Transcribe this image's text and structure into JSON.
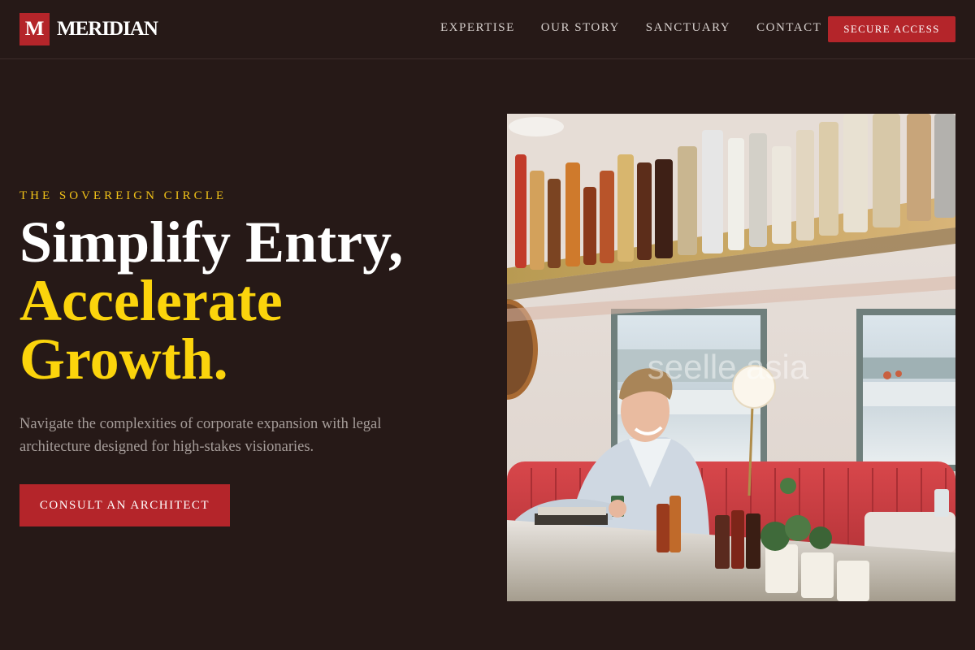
{
  "brand": {
    "mark": "M",
    "name": "MERIDIAN"
  },
  "nav": {
    "items": [
      {
        "label": "EXPERTISE"
      },
      {
        "label": "OUR STORY"
      },
      {
        "label": "SANCTUARY"
      },
      {
        "label": "CONTACT"
      }
    ],
    "cta_label": "SECURE ACCESS"
  },
  "hero": {
    "eyebrow": "THE SOVEREIGN CIRCLE",
    "headline_line1": "Simplify Entry,",
    "headline_line2": "Accelerate",
    "headline_line3": "Growth.",
    "subcopy": "Navigate the complexities of corporate expansion with legal architecture designed for high-stakes visionaries.",
    "cta_label": "CONSULT AN ARCHITECT",
    "image": {
      "alt": "Smiling man holding a drink at a bar with bottles on shelves and red booth seating",
      "watermark": "seelle asia"
    }
  },
  "colors": {
    "background": "#261917",
    "accent_red": "#b4252a",
    "accent_yellow": "#fbd40c",
    "eyebrow_gold": "#f2c318",
    "muted_text": "#a59c99"
  }
}
